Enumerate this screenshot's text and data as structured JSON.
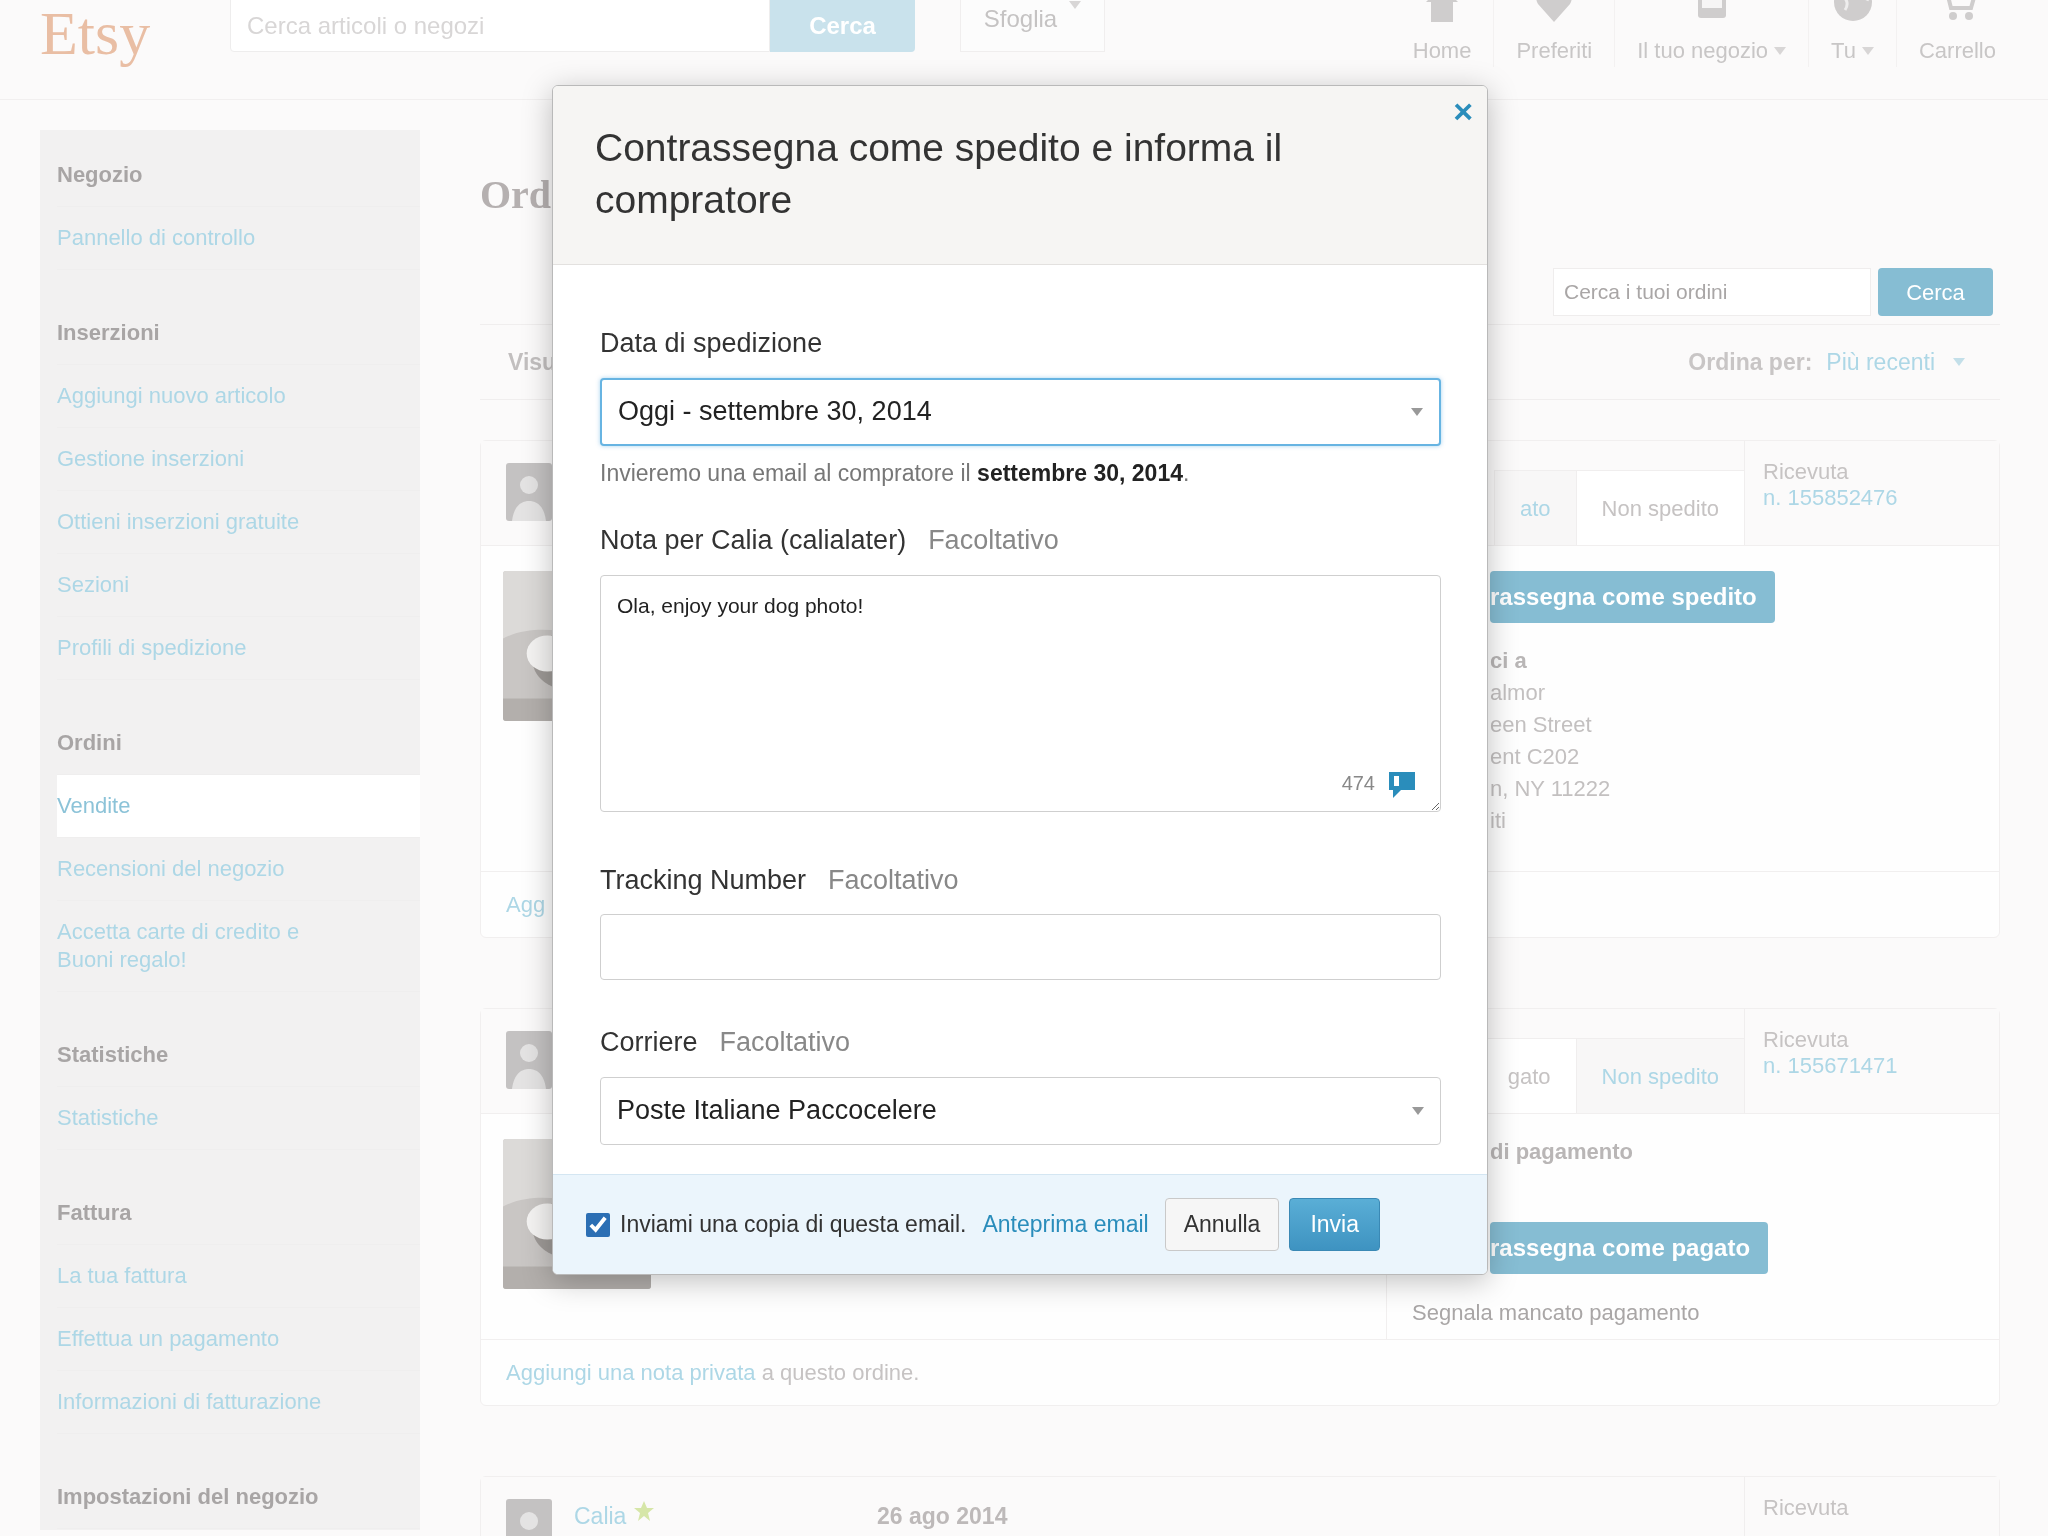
{
  "header": {
    "logo": "Etsy",
    "search": {
      "placeholder": "Cerca articoli o negozi"
    },
    "search_button": "Cerca",
    "browse": "Sfoglia",
    "nav": [
      {
        "label": "Home",
        "kind": "house",
        "dropdown": false
      },
      {
        "label": "Preferiti",
        "kind": "heart",
        "dropdown": false
      },
      {
        "label": "Il tuo negozio",
        "kind": "shop",
        "dropdown": true
      },
      {
        "label": "Tu",
        "kind": "globe",
        "dropdown": true
      },
      {
        "label": "Carrello",
        "kind": "cart",
        "dropdown": false
      }
    ]
  },
  "sidebar": {
    "sections": [
      {
        "heading": "Negozio",
        "items": [
          {
            "label": "Pannello di controllo",
            "selected": false
          }
        ]
      },
      {
        "heading": "Inserzioni",
        "items": [
          {
            "label": "Aggiungi nuovo articolo",
            "selected": false
          },
          {
            "label": "Gestione inserzioni",
            "selected": false
          },
          {
            "label": "Ottieni inserzioni gratuite",
            "selected": false
          },
          {
            "label": "Sezioni",
            "selected": false
          },
          {
            "label": "Profili di spedizione",
            "selected": false
          }
        ]
      },
      {
        "heading": "Ordini",
        "items": [
          {
            "label": "Vendite",
            "selected": true
          },
          {
            "label": "Recensioni del negozio",
            "selected": false
          },
          {
            "label": "Accetta carte di credito e Buoni regalo!",
            "selected": false
          }
        ]
      },
      {
        "heading": "Statistiche",
        "items": [
          {
            "label": "Statistiche",
            "selected": false
          }
        ]
      },
      {
        "heading": "Fattura",
        "items": [
          {
            "label": "La tua fattura",
            "selected": false
          },
          {
            "label": "Effettua un pagamento",
            "selected": false
          },
          {
            "label": "Informazioni di fatturazione",
            "selected": false
          }
        ]
      },
      {
        "heading": "Impostazioni del negozio"
      }
    ]
  },
  "main": {
    "title": "Ord",
    "order_search": {
      "placeholder": "Cerca i tuoi ordini"
    },
    "order_search_button": "Cerca",
    "view": "Visu",
    "sort_label": "Ordina per:",
    "sort_value": "Più recenti"
  },
  "orders": [
    {
      "kind": "shipping",
      "tabs": [
        {
          "label": "ato",
          "selected": false
        },
        {
          "label": "Non spedito",
          "selected": true
        }
      ],
      "receipt_label": "Ricevuta",
      "receipt_number": "n. 155852476",
      "action_button": "rassegna come spedito",
      "address_heading": "ci a",
      "address_lines": [
        "almor",
        "een Street",
        "ent C202",
        "n, NY 11222",
        "iti"
      ],
      "footer_link": "Agg"
    },
    {
      "kind": "payment",
      "tabs": [
        {
          "label": "gato",
          "selected": true
        },
        {
          "label": "Non spedito",
          "selected": false
        }
      ],
      "receipt_label": "Ricevuta",
      "receipt_number": "n. 155671471",
      "payment_heading": "di pagamento",
      "action_button": "rassegna come pagato",
      "secondary_link": "Segnala mancato pagamento",
      "footer_link": "Aggiungi una nota privata",
      "footer_rest": "a questo ordine."
    },
    {
      "kind": "summary",
      "buyer": "Calia",
      "starred": true,
      "date": "26 ago 2014",
      "receipt_label": "Ricevuta"
    }
  ],
  "modal": {
    "title": "Contrassegna come spedito e informa il compratore",
    "close": "×",
    "ship_date": {
      "label": "Data di spedizione",
      "value": "Oggi - settembre 30, 2014",
      "help": "Invieremo una email al compratore il **settembre 30, 2014**."
    },
    "note": {
      "label": "Nota per Calia (calialater)",
      "optional": "Facoltativo",
      "value": "Ola, enjoy your dog photo!",
      "counter": "474"
    },
    "tracking": {
      "label": "Tracking Number",
      "optional": "Facoltativo"
    },
    "carrier": {
      "label": "Corriere",
      "optional": "Facoltativo",
      "value": "Poste Italiane Paccocelere"
    },
    "copy": {
      "label": "Inviami una copia di questa email.",
      "checked": true
    },
    "preview_link": "Anteprima email",
    "cancel": "Annulla",
    "submit": "Invia"
  }
}
